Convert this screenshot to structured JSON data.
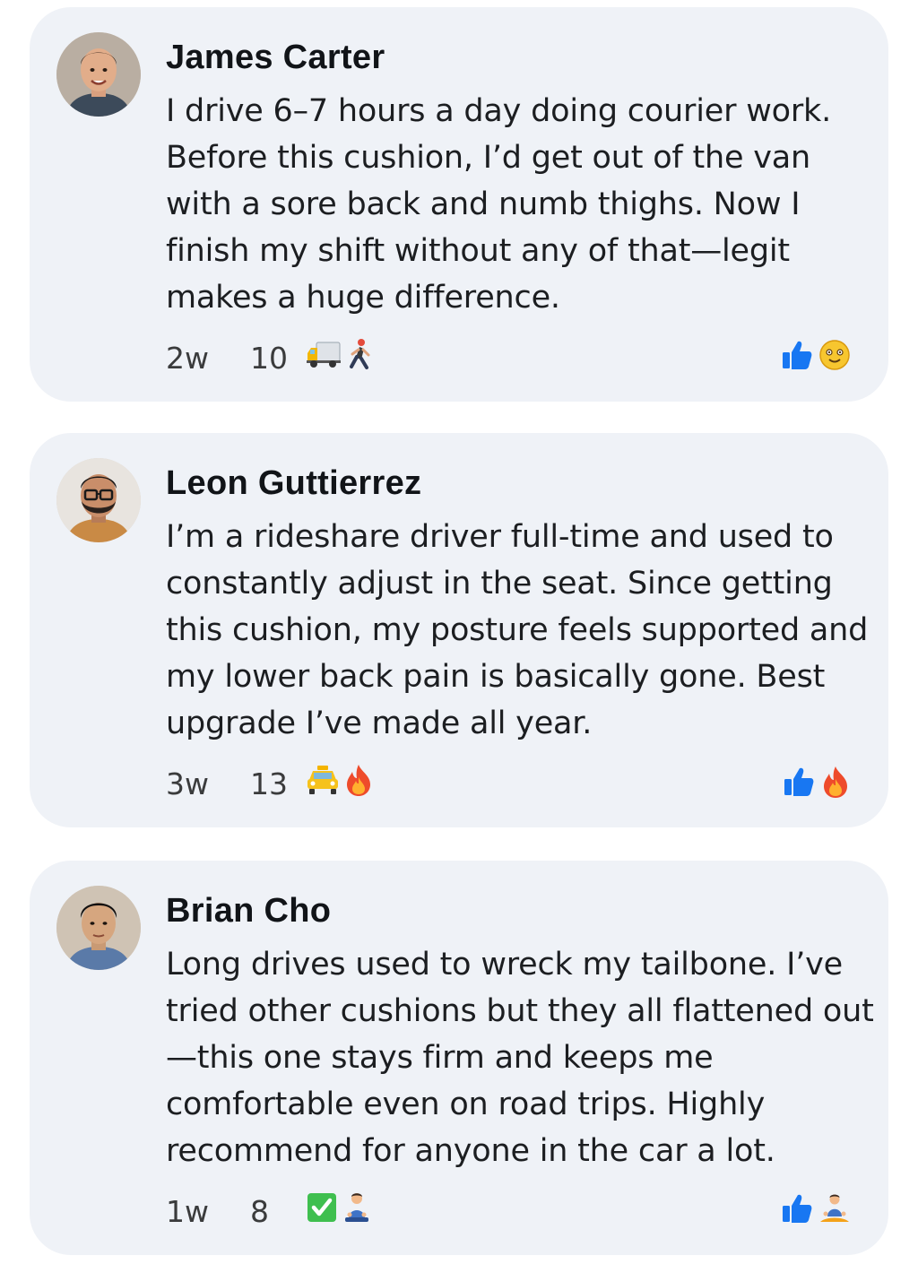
{
  "comments": [
    {
      "name": "James Carter",
      "text": "I drive 6–7 hours a day doing courier work. Before this cushion, I’d get out of the van with a sore back and numb thighs. Now I finish my shift without any of that—legit makes a huge difference.",
      "time": "2w",
      "count": "10",
      "emojis": [
        "delivery-truck-icon",
        "person-walking-icon"
      ],
      "reactions": [
        "thumbs-up-icon",
        "smiling-face-icon"
      ]
    },
    {
      "name": "Leon Guttierrez",
      "text": "I’m a rideshare driver full-time and used to constantly adjust in the seat. Since getting this cushion, my posture feels supported and my lower back pain is basically gone. Best upgrade I’ve made all year.",
      "time": "3w",
      "count": "13",
      "emojis": [
        "taxi-icon",
        "fire-icon"
      ],
      "reactions": [
        "thumbs-up-icon",
        "fire-icon"
      ]
    },
    {
      "name": "Brian Cho",
      "text": "Long drives used to wreck my tailbone. I’ve tried other cushions but they all flattened out—this one stays firm and keeps me comfortable even on road trips. Highly recommend for anyone in the car a lot.",
      "time": "1w",
      "count": "8",
      "emojis": [
        "check-mark-button-icon",
        "person-sitting-icon"
      ],
      "reactions": [
        "thumbs-up-icon",
        "person-meditating-icon"
      ]
    }
  ],
  "colors": {
    "card_background": "#eff2f7",
    "like_blue": "#1877f2",
    "name_text": "#111418",
    "meta_text": "#3a3b3c"
  }
}
